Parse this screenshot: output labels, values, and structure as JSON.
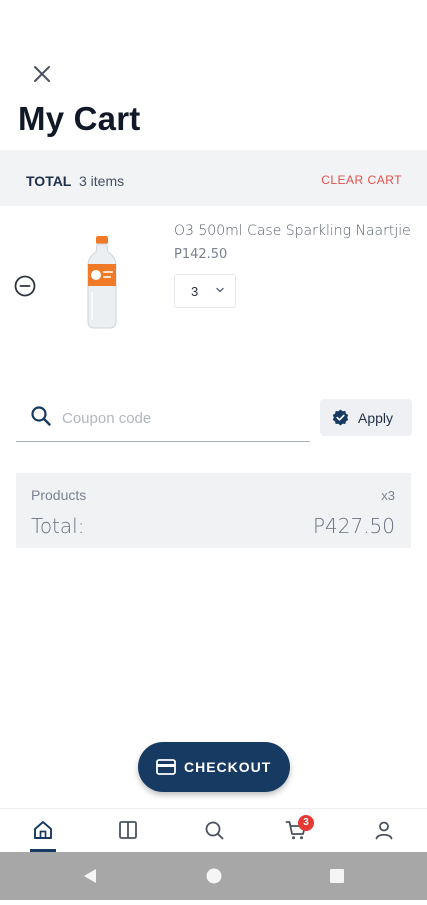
{
  "header": {
    "title": "My Cart",
    "close_icon": "close-icon"
  },
  "summary_bar": {
    "total_label": "TOTAL",
    "item_count": "3 items",
    "clear_cart": "CLEAR CART"
  },
  "cart_items": [
    {
      "name": "O3 500ml Case Sparkling Naartjie",
      "price": "P142.50",
      "quantity": "3"
    }
  ],
  "coupon": {
    "placeholder": "Coupon code",
    "value": "",
    "apply_label": "Apply"
  },
  "totals": {
    "products_label": "Products",
    "products_count": "x3",
    "total_label": "Total:",
    "total_value": "P427.50"
  },
  "checkout": {
    "label": "CHECKOUT"
  },
  "bottom_nav": {
    "items": [
      {
        "icon": "home-icon",
        "active": true
      },
      {
        "icon": "catalog-icon",
        "active": false
      },
      {
        "icon": "search-icon",
        "active": false
      },
      {
        "icon": "cart-icon",
        "active": false,
        "badge": "3"
      },
      {
        "icon": "profile-icon",
        "active": false
      }
    ]
  },
  "colors": {
    "primary": "#173a63",
    "danger": "#e0524f",
    "badge": "#e53935",
    "panel": "#f1f3f5"
  }
}
